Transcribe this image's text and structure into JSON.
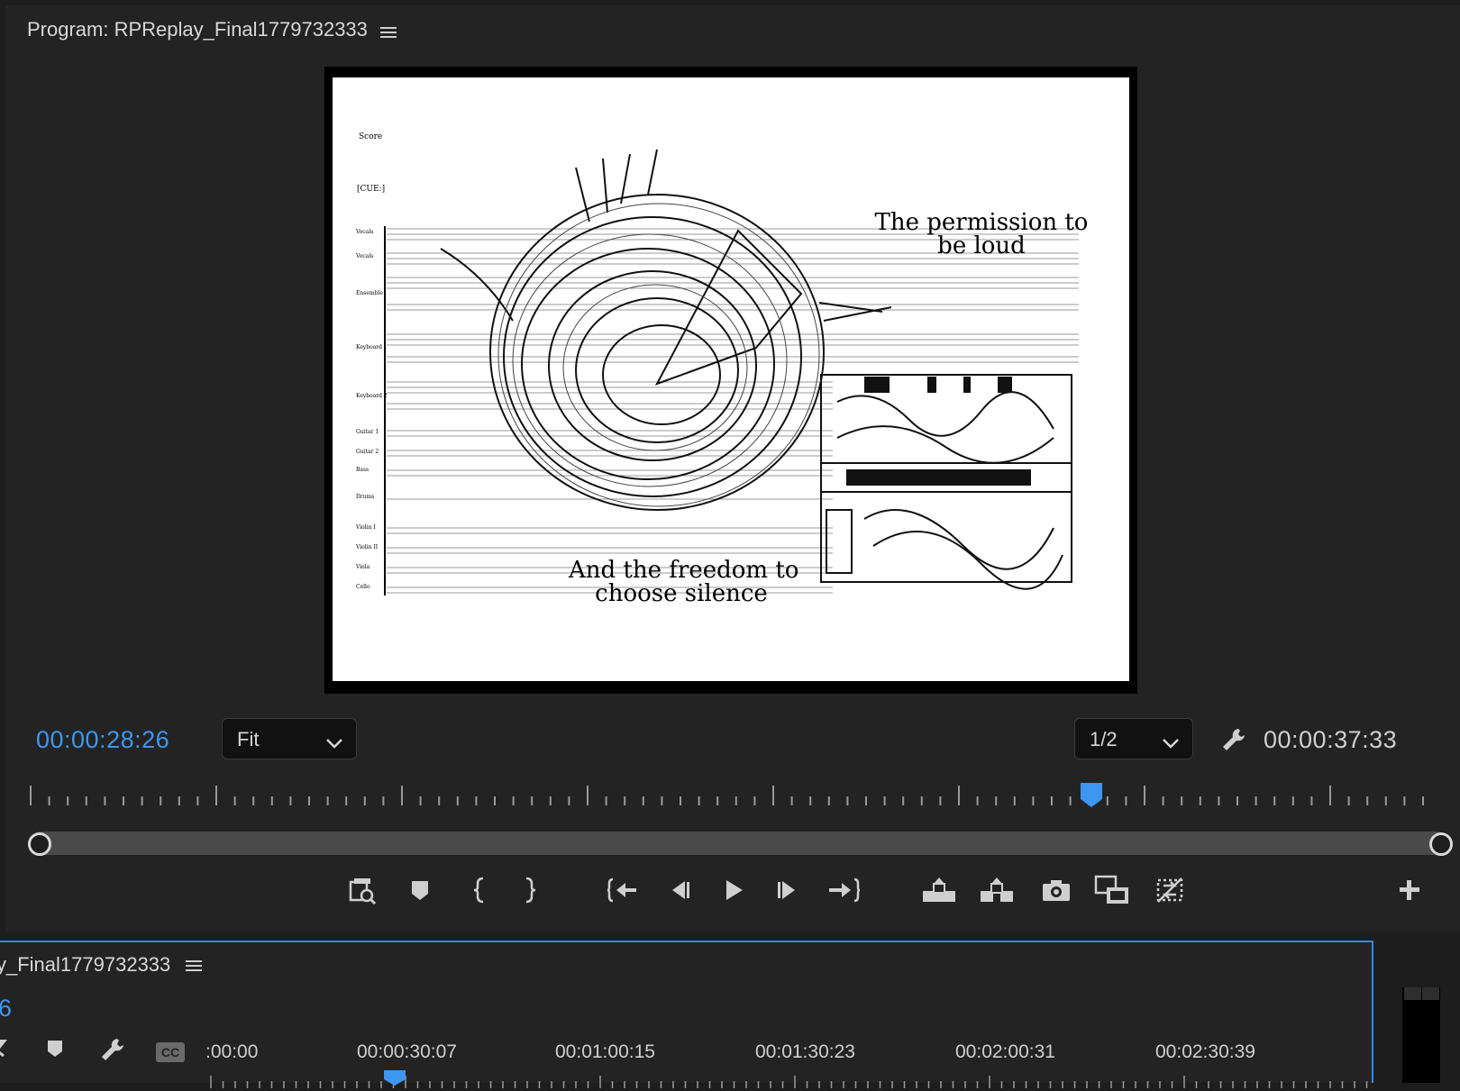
{
  "program_monitor": {
    "title": "Program: RPReplay_Final1779732333",
    "menu_icon": "hamburger-icon",
    "score": {
      "header_label": "Score",
      "cue_label": "[CUE:]",
      "instruments": [
        "Vocals",
        "Vocals",
        "Ensemble",
        "Keyboard 1",
        "Keyboard 2",
        "Guitar 1",
        "Guitar 2",
        "Bass",
        "Drums",
        "Violin I",
        "Violin II",
        "Viola",
        "Cello"
      ],
      "text_top_line1": "The permission to",
      "text_top_line2": "be loud",
      "text_bottom_line1": "And the freedom to",
      "text_bottom_line2": "choose silence"
    },
    "current_timecode": "00:00:28:26",
    "zoom_select": {
      "value": "Fit"
    },
    "resolution_select": {
      "value": "1/2"
    },
    "duration_timecode": "00:00:37:33",
    "playhead_fraction": 0.737,
    "transport_buttons": [
      "insert-view-icon",
      "add-marker-icon",
      "mark-in-icon",
      "mark-out-icon",
      "go-to-in-icon",
      "step-back-icon",
      "play-icon",
      "step-forward-icon",
      "go-to-out-icon",
      "lift-icon",
      "extract-icon",
      "export-frame-icon",
      "compare-view-icon",
      "toggle-proxies-icon",
      "add-button-icon"
    ],
    "accent_color": "#3d97f0"
  },
  "timeline": {
    "title": "y_Final1779732333",
    "menu_icon": "hamburger-icon",
    "timecode": "6",
    "time_labels": [
      ":00:00",
      "00:00:30:07",
      "00:01:00:15",
      "00:01:30:23",
      "00:02:00:31",
      "00:02:30:39"
    ],
    "cc_label": "CC"
  }
}
